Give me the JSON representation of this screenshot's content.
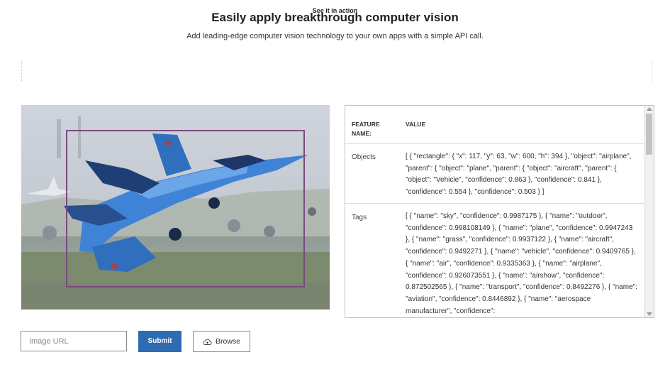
{
  "hero": {
    "title": "Easily apply breakthrough computer vision",
    "subtitle": "Add leading-edge computer vision technology to your own apps with a simple API call."
  },
  "demo": {
    "label": "See it in action"
  },
  "results_table": {
    "header_feature": "FEATURE NAME:",
    "header_value": "VALUE",
    "rows": [
      {
        "name": "Objects",
        "value": "[ { \"rectangle\": { \"x\": 117, \"y\": 63, \"w\": 600, \"h\": 394 }, \"object\": \"airplane\", \"parent\": { \"object\": \"plane\", \"parent\": { \"object\": \"aircraft\", \"parent\": { \"object\": \"Vehicle\", \"confidence\": 0.863 }, \"confidence\": 0.841 }, \"confidence\": 0.554 }, \"confidence\": 0.503 } ]"
      },
      {
        "name": "Tags",
        "value": "[ { \"name\": \"sky\", \"confidence\": 0.9987175 }, { \"name\": \"outdoor\", \"confidence\": 0.998108149 }, { \"name\": \"plane\", \"confidence\": 0.9947243 }, { \"name\": \"grass\", \"confidence\": 0.9937122 }, { \"name\": \"aircraft\", \"confidence\": 0.9492271 }, { \"name\": \"vehicle\", \"confidence\": 0.9409765 }, { \"name\": \"air\", \"confidence\": 0.9335363 }, { \"name\": \"airplane\", \"confidence\": 0.926073551 }, { \"name\": \"airshow\", \"confidence\": 0.872502565 }, { \"name\": \"transport\", \"confidence\": 0.8492276 }, { \"name\": \"aviation\", \"confidence\": 0.8446892 }, { \"name\": \"aerospace manufacturer\", \"confidence\":"
      }
    ]
  },
  "controls": {
    "url_placeholder": "Image URL",
    "submit_label": "Submit",
    "browse_label": "Browse"
  },
  "colors": {
    "accent": "#2e6cb2",
    "bounding_box": "#7a4a7e",
    "jet_blue": "#3f83d6"
  },
  "icons": {
    "browse": "cloud-upload-icon",
    "scroll_up": "arrow-up-icon",
    "scroll_down": "arrow-down-icon"
  }
}
